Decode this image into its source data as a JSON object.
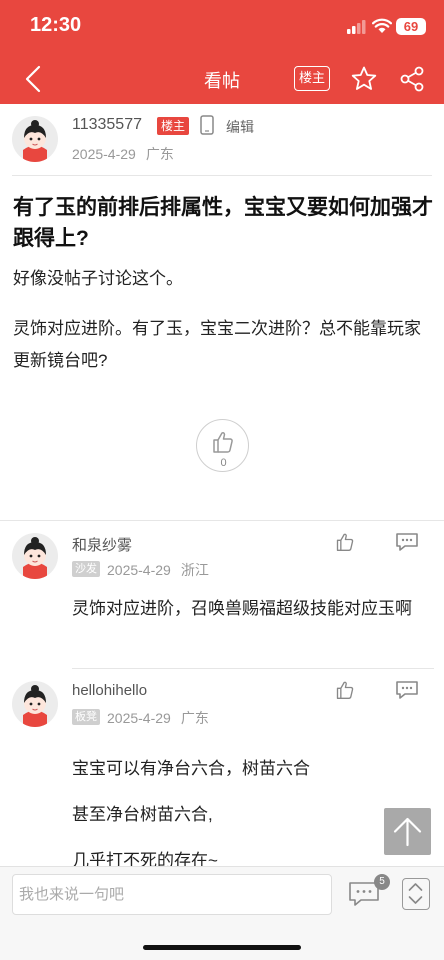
{
  "status": {
    "time": "12:30",
    "battery": "69"
  },
  "nav": {
    "title": "看帖",
    "op_badge": "楼主"
  },
  "post": {
    "author": "11335577",
    "op_tag": "楼主",
    "edit": "编辑",
    "date": "2025-4-29",
    "region": "广东",
    "title": "有了玉的前排后排属性，宝宝又要如何加强才跟得上?",
    "body": [
      "好像没帖子讨论这个。",
      "灵饰对应进阶。有了玉，宝宝二次进阶？总不能靠玩家更新镜台吧?"
    ],
    "likes": "0"
  },
  "replies": [
    {
      "name": "和泉纱雾",
      "floor": "沙发",
      "date": "2025-4-29",
      "region": "浙江",
      "body": [
        "灵饰对应进阶，召唤兽赐福超级技能对应玉啊"
      ]
    },
    {
      "name": "hellohihello",
      "floor": "板凳",
      "date": "2025-4-29",
      "region": "广东",
      "body": [
        "宝宝可以有净台六合，树苗六合",
        "甚至净台树苗六合,",
        "几乎打不死的存在~"
      ]
    }
  ],
  "footer": {
    "placeholder": "我也来说一句吧",
    "comment_count": "5"
  },
  "icons": [
    "back-arrow-icon",
    "star-icon",
    "share-icon",
    "phone-icon",
    "thumbs-up-icon",
    "reply-icon",
    "arrow-up-icon",
    "comment-icon",
    "scroll-icon"
  ],
  "colors": {
    "brand": "#e8473f"
  }
}
